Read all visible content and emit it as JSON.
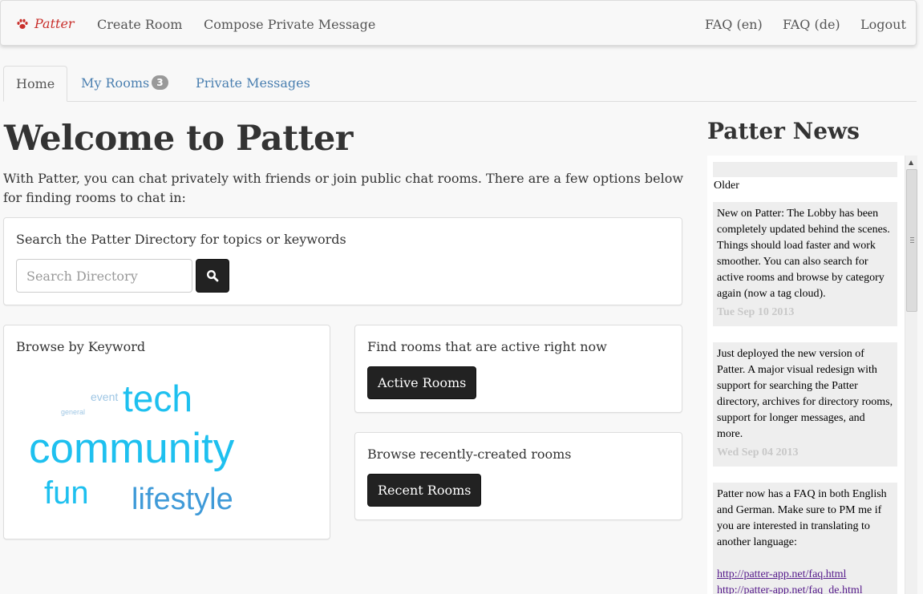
{
  "navbar": {
    "brand": "Patter",
    "left_links": [
      "Create Room",
      "Compose Private Message"
    ],
    "right_links": [
      "FAQ (en)",
      "FAQ (de)",
      "Logout"
    ]
  },
  "tabs": [
    {
      "label": "Home",
      "active": true
    },
    {
      "label": "My Rooms",
      "badge": "3"
    },
    {
      "label": "Private Messages"
    }
  ],
  "main": {
    "title": "Welcome to Patter",
    "intro": "With Patter, you can chat privately with friends or join public chat rooms. There are a few options below for finding rooms to chat in:",
    "search": {
      "label": "Search the Patter Directory for topics or keywords",
      "placeholder": "Search Directory",
      "button_icon": "search-icon"
    },
    "keywords": {
      "label": "Browse by Keyword",
      "tags": [
        "event",
        "tech",
        "general",
        "community",
        "fun",
        "lifestyle"
      ]
    },
    "active": {
      "label": "Find rooms that are active right now",
      "button": "Active Rooms"
    },
    "recent": {
      "label": "Browse recently-created rooms",
      "button": "Recent Rooms"
    }
  },
  "news": {
    "title": "Patter News",
    "older_label": "Older",
    "items": [
      {
        "text": "New on Patter: The Lobby has been completely updated behind the scenes. Things should load faster and work smoother. You can also search for active rooms and browse by category again (now a tag cloud).",
        "date": "Tue Sep 10 2013"
      },
      {
        "text": "Just deployed the new version of Patter. A major visual redesign with support for searching the Patter directory, archives for directory rooms, support for longer messages, and more.",
        "date": "Wed Sep 04 2013"
      },
      {
        "text": "Patter now has a FAQ in both English and German. Make sure to PM me if you are interested in translating to another language:",
        "links": [
          "http://patter-app.net/faq.html",
          "http://patter-app.net/faq_de.html"
        ]
      }
    ]
  },
  "colors": {
    "brand": "#c9302c",
    "link": "#4a7fb0",
    "tag_light": "#9ec6e4",
    "tag_bright": "#1ec0ef",
    "tag_mid": "#3f9ad8",
    "button_dark": "#222222"
  }
}
